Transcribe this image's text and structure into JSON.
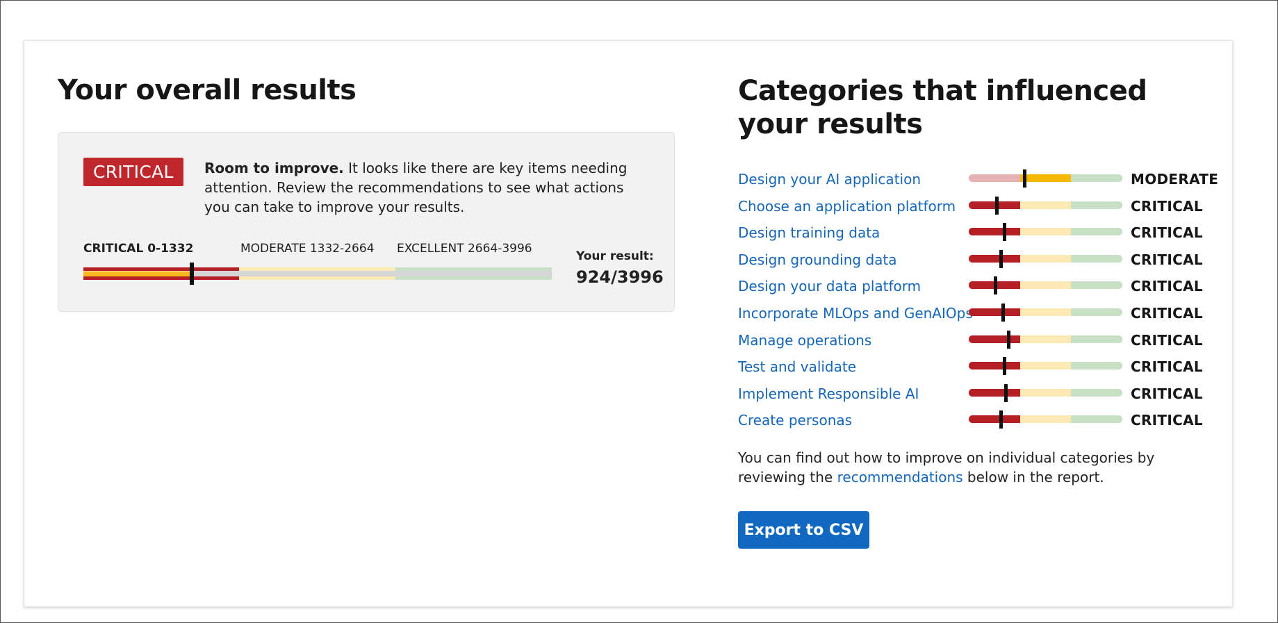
{
  "overall": {
    "title": "Your overall results",
    "status": "CRITICAL",
    "summary_bold": "Room to improve.",
    "summary_text": "It looks like there are key items needing attention. Review the recommendations to see what actions you can take to improve your results.",
    "scale": [
      {
        "label": "CRITICAL 0-1332",
        "color": "#b52026"
      },
      {
        "label": "MODERATE 1332-2664",
        "color": "#fce9b3"
      },
      {
        "label": "EXCELLENT 2664-3996",
        "color": "#c8e1c6"
      }
    ],
    "result_label": "Your result:",
    "result_value": "924/3996",
    "score": 924,
    "max_score": 3996
  },
  "categories": {
    "title": "Categories that influenced your results",
    "items": [
      {
        "name": "Design your AI application",
        "status": "MODERATE",
        "level": 0.36
      },
      {
        "name": "Choose an application platform",
        "status": "CRITICAL",
        "level": 0.18
      },
      {
        "name": "Design training data",
        "status": "CRITICAL",
        "level": 0.23
      },
      {
        "name": "Design grounding data",
        "status": "CRITICAL",
        "level": 0.21
      },
      {
        "name": "Design your data platform",
        "status": "CRITICAL",
        "level": 0.17
      },
      {
        "name": "Incorporate MLOps and GenAIOps",
        "status": "CRITICAL",
        "level": 0.22
      },
      {
        "name": "Manage operations",
        "status": "CRITICAL",
        "level": 0.26
      },
      {
        "name": "Test and validate",
        "status": "CRITICAL",
        "level": 0.23
      },
      {
        "name": "Implement Responsible AI",
        "status": "CRITICAL",
        "level": 0.24
      },
      {
        "name": "Create personas",
        "status": "CRITICAL",
        "level": 0.21
      }
    ]
  },
  "footnote": {
    "before": "You can find out how to improve on individual categories by reviewing the ",
    "link": "recommendations",
    "after": " below in the report."
  },
  "export_button": "Export to CSV"
}
